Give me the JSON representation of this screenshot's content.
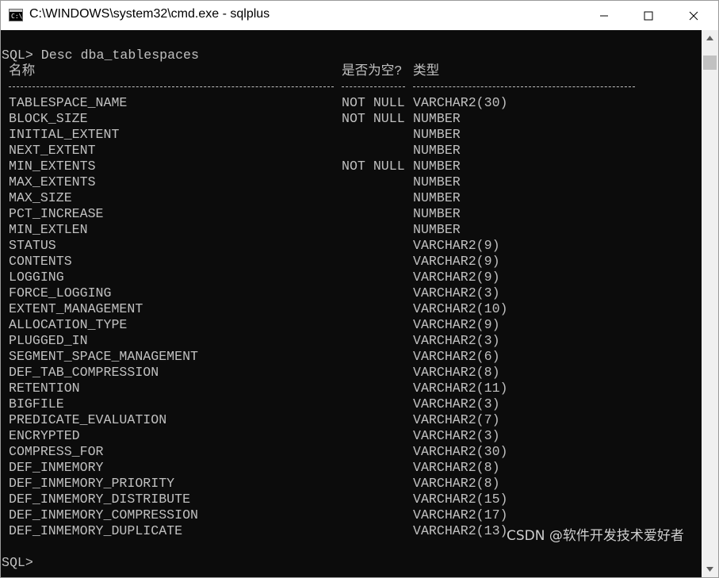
{
  "window": {
    "title": "C:\\WINDOWS\\system32\\cmd.exe - sqlplus",
    "icon": "console-app-icon",
    "icon_text": "C:\\"
  },
  "console": {
    "command_line": "SQL> Desc dba_tablespaces",
    "headers": {
      "name": "名称",
      "nullable": "是否为空?",
      "type": "类型"
    },
    "rows": [
      {
        "name": "TABLESPACE_NAME",
        "nullable": "NOT NULL",
        "type": "VARCHAR2(30)"
      },
      {
        "name": "BLOCK_SIZE",
        "nullable": "NOT NULL",
        "type": "NUMBER"
      },
      {
        "name": "INITIAL_EXTENT",
        "nullable": "",
        "type": "NUMBER"
      },
      {
        "name": "NEXT_EXTENT",
        "nullable": "",
        "type": "NUMBER"
      },
      {
        "name": "MIN_EXTENTS",
        "nullable": "NOT NULL",
        "type": "NUMBER"
      },
      {
        "name": "MAX_EXTENTS",
        "nullable": "",
        "type": "NUMBER"
      },
      {
        "name": "MAX_SIZE",
        "nullable": "",
        "type": "NUMBER"
      },
      {
        "name": "PCT_INCREASE",
        "nullable": "",
        "type": "NUMBER"
      },
      {
        "name": "MIN_EXTLEN",
        "nullable": "",
        "type": "NUMBER"
      },
      {
        "name": "STATUS",
        "nullable": "",
        "type": "VARCHAR2(9)"
      },
      {
        "name": "CONTENTS",
        "nullable": "",
        "type": "VARCHAR2(9)"
      },
      {
        "name": "LOGGING",
        "nullable": "",
        "type": "VARCHAR2(9)"
      },
      {
        "name": "FORCE_LOGGING",
        "nullable": "",
        "type": "VARCHAR2(3)"
      },
      {
        "name": "EXTENT_MANAGEMENT",
        "nullable": "",
        "type": "VARCHAR2(10)"
      },
      {
        "name": "ALLOCATION_TYPE",
        "nullable": "",
        "type": "VARCHAR2(9)"
      },
      {
        "name": "PLUGGED_IN",
        "nullable": "",
        "type": "VARCHAR2(3)"
      },
      {
        "name": "SEGMENT_SPACE_MANAGEMENT",
        "nullable": "",
        "type": "VARCHAR2(6)"
      },
      {
        "name": "DEF_TAB_COMPRESSION",
        "nullable": "",
        "type": "VARCHAR2(8)"
      },
      {
        "name": "RETENTION",
        "nullable": "",
        "type": "VARCHAR2(11)"
      },
      {
        "name": "BIGFILE",
        "nullable": "",
        "type": "VARCHAR2(3)"
      },
      {
        "name": "PREDICATE_EVALUATION",
        "nullable": "",
        "type": "VARCHAR2(7)"
      },
      {
        "name": "ENCRYPTED",
        "nullable": "",
        "type": "VARCHAR2(3)"
      },
      {
        "name": "COMPRESS_FOR",
        "nullable": "",
        "type": "VARCHAR2(30)"
      },
      {
        "name": "DEF_INMEMORY",
        "nullable": "",
        "type": "VARCHAR2(8)"
      },
      {
        "name": "DEF_INMEMORY_PRIORITY",
        "nullable": "",
        "type": "VARCHAR2(8)"
      },
      {
        "name": "DEF_INMEMORY_DISTRIBUTE",
        "nullable": "",
        "type": "VARCHAR2(15)"
      },
      {
        "name": "DEF_INMEMORY_COMPRESSION",
        "nullable": "",
        "type": "VARCHAR2(17)"
      },
      {
        "name": "DEF_INMEMORY_DUPLICATE",
        "nullable": "",
        "type": "VARCHAR2(13)"
      }
    ],
    "prompt": "SQL>",
    "text_color": "#c0c0c0",
    "background": "#0c0c0c"
  },
  "watermark": "CSDN @软件开发技术爱好者"
}
